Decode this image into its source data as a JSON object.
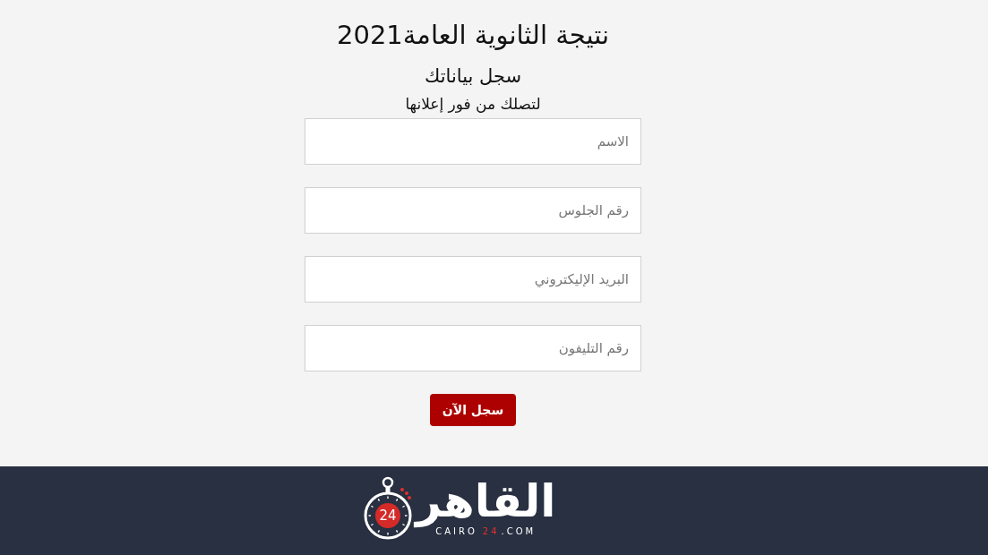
{
  "title": "نتيجة الثانوية العامة2021",
  "subtitle": "سجل بياناتك",
  "tagline": "لتصلك من فور إعلانها",
  "form": {
    "fields": [
      {
        "placeholder": "الاسم"
      },
      {
        "placeholder": "رقم الجلوس"
      },
      {
        "placeholder": "البريد الإليكتروني"
      },
      {
        "placeholder": "رقم التليفون"
      }
    ],
    "submit": "سجل الآن"
  },
  "footer": {
    "logo": {
      "badge": "24",
      "wordmark": "القاهر",
      "domain_name": "CAIRO",
      "domain_number": "24",
      "domain_suffix": ".COM"
    }
  }
}
